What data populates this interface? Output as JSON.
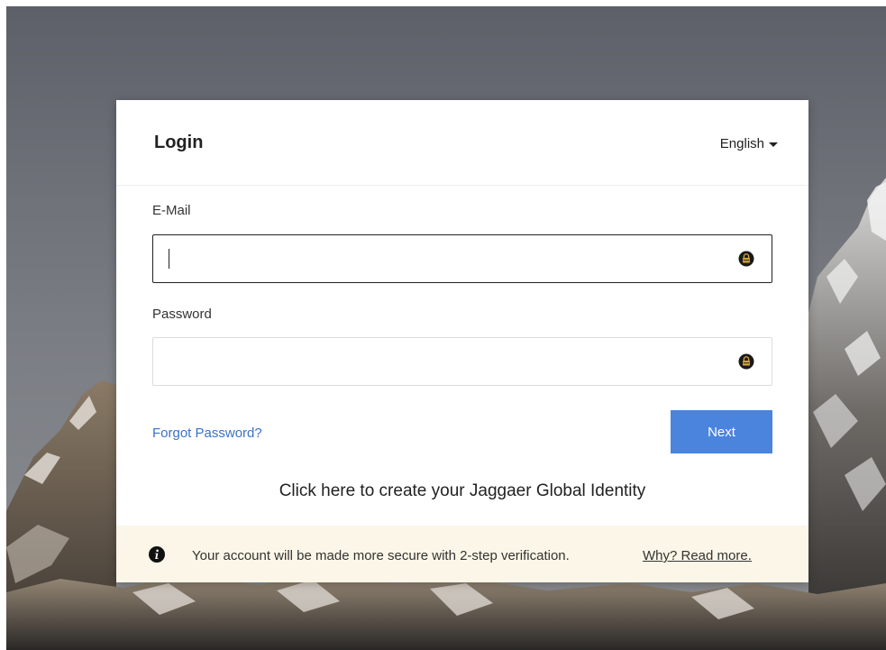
{
  "header": {
    "title": "Login",
    "language": "English"
  },
  "email": {
    "label": "E-Mail",
    "value": "",
    "icon": "password-manager-icon"
  },
  "password": {
    "label": "Password",
    "value": "",
    "icon": "password-manager-icon"
  },
  "actions": {
    "forgot_password": "Forgot Password?",
    "next": "Next",
    "create_identity": "Click here to create your Jaggaer Global Identity"
  },
  "notice": {
    "icon": "info-icon",
    "text": "Your account will be made more secure with 2-step verification.",
    "link": "Why? Read more."
  },
  "colors": {
    "accent": "#4a84dc",
    "link": "#3a72c4",
    "notice_bg": "#fbf6e7"
  }
}
